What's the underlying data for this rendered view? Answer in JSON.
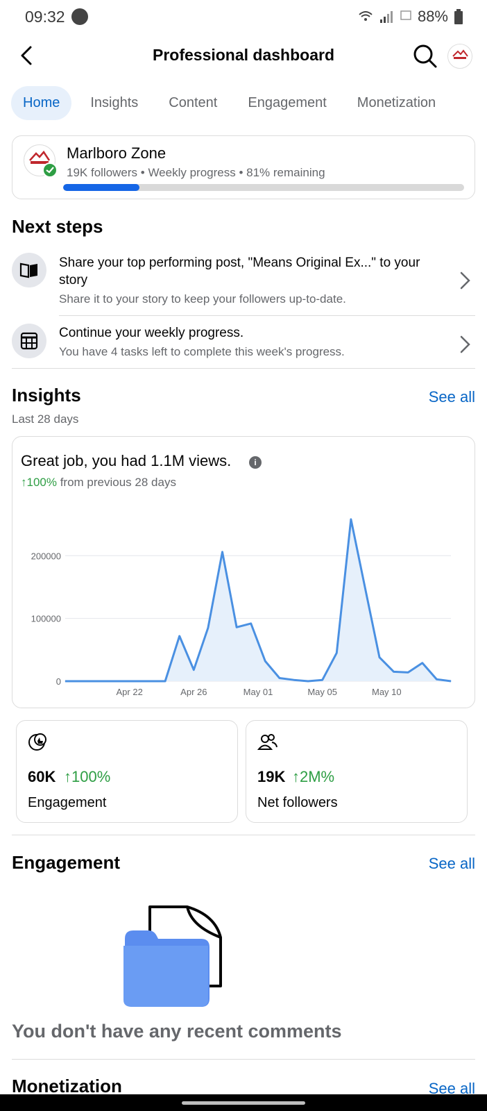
{
  "status_bar": {
    "time": "09:32",
    "battery": "88%"
  },
  "header": {
    "title": "Professional dashboard"
  },
  "tabs": [
    {
      "label": "Home",
      "active": true
    },
    {
      "label": "Insights",
      "active": false
    },
    {
      "label": "Content",
      "active": false
    },
    {
      "label": "Engagement",
      "active": false
    },
    {
      "label": "Monetization",
      "active": false
    }
  ],
  "profile": {
    "name": "Marlboro Zone",
    "meta": "19K followers • Weekly progress • 81% remaining",
    "weekly_progress_fraction": 0.19
  },
  "next_steps": {
    "title": "Next steps",
    "items": [
      {
        "title": "Share your top performing post, \"Means Original Ex...\" to your story",
        "subtitle": "Share it to your story to keep your followers up-to-date.",
        "icon": "book-icon"
      },
      {
        "title": "Continue your weekly progress.",
        "subtitle": "You have 4 tasks left to complete this week's progress.",
        "icon": "calendar-icon"
      }
    ]
  },
  "insights": {
    "title": "Insights",
    "see_all": "See all",
    "period": "Last 28 days",
    "headline": "Great job, you had 1.1M views.",
    "change": "↑100%",
    "change_suffix": " from previous 28 days"
  },
  "chart_data": {
    "type": "area",
    "x": [
      "Apr 18",
      "Apr 19",
      "Apr 20",
      "Apr 21",
      "Apr 22",
      "Apr 23",
      "Apr 24",
      "Apr 25",
      "Apr 26",
      "Apr 27",
      "Apr 28",
      "Apr 29",
      "Apr 30",
      "May 01",
      "May 02",
      "May 03",
      "May 04",
      "May 05",
      "May 06",
      "May 07",
      "May 08",
      "May 09",
      "May 10",
      "May 11",
      "May 12",
      "May 13",
      "May 14",
      "May 15"
    ],
    "values": [
      0,
      0,
      0,
      0,
      0,
      0,
      0,
      0,
      72000,
      18000,
      85000,
      206000,
      86000,
      92000,
      32000,
      5000,
      2000,
      0,
      2000,
      45000,
      258000,
      148000,
      38000,
      15000,
      14000,
      29000,
      3000,
      0
    ],
    "x_ticks": [
      "Apr 22",
      "Apr 26",
      "May 01",
      "May 05",
      "May 10"
    ],
    "x_tick_index": [
      4.5,
      9,
      13.5,
      18,
      22.5
    ],
    "y_ticks": [
      0,
      100000,
      200000
    ],
    "y_tick_labels": [
      "0",
      "100000",
      "200000"
    ],
    "ylim": [
      0,
      290000
    ],
    "grid": true,
    "color": "#4a90e2"
  },
  "stats": [
    {
      "value": "60K",
      "change": "↑100%",
      "label": "Engagement",
      "icon": "engagement-icon"
    },
    {
      "value": "19K",
      "change": "↑2M%",
      "label": "Net followers",
      "icon": "followers-icon"
    }
  ],
  "engagement": {
    "title": "Engagement",
    "see_all": "See all",
    "empty_text": "You don't have any recent comments"
  },
  "monetization": {
    "title": "Monetization",
    "see_all": "See all"
  },
  "colors": {
    "accent": "#0866c6",
    "positive": "#2e9e44",
    "progress": "#1566e6"
  }
}
